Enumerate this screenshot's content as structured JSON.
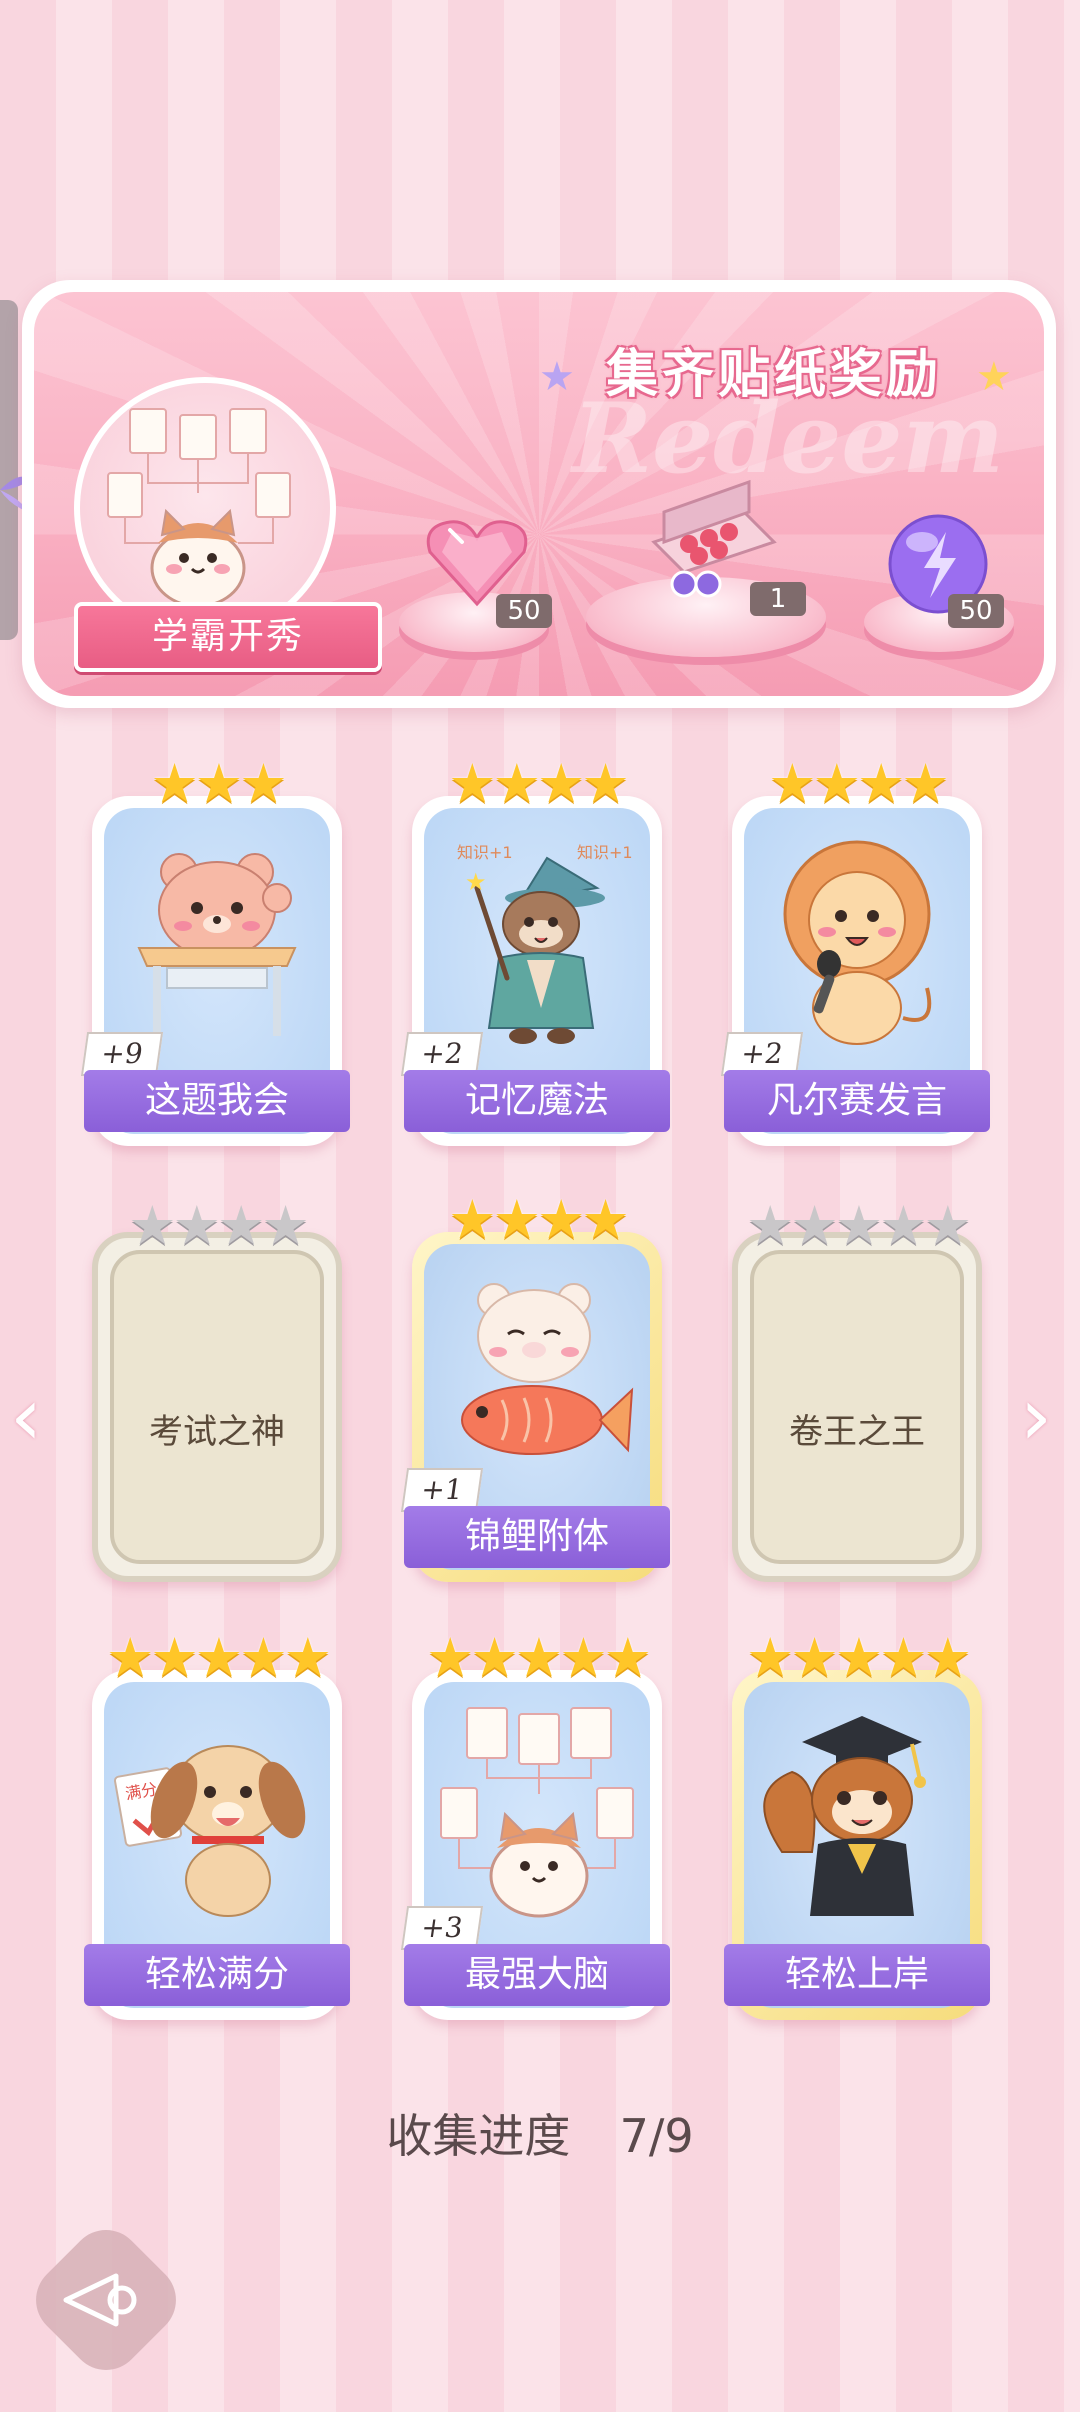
{
  "banner": {
    "title": "集齐贴纸奖励",
    "watermark": "Redeem",
    "ribbon_label": "学霸开秀",
    "rewards": [
      {
        "icon": "pink-gem-heart-icon",
        "count": "50"
      },
      {
        "icon": "gift-box-icon",
        "count": "1"
      },
      {
        "icon": "lightning-orb-icon",
        "count": "50"
      }
    ]
  },
  "cards": [
    {
      "label": "这题我会",
      "stars": 3,
      "max_stars": 3,
      "bonus": "+9",
      "state": "collected",
      "critter": "bear-at-desk"
    },
    {
      "label": "记忆魔法",
      "stars": 4,
      "max_stars": 4,
      "bonus": "+2",
      "state": "collected",
      "critter": "otter-wizard"
    },
    {
      "label": "凡尔赛发言",
      "stars": 4,
      "max_stars": 4,
      "bonus": "+2",
      "state": "collected",
      "critter": "lion-mic"
    },
    {
      "label": "考试之神",
      "stars": 0,
      "max_stars": 4,
      "bonus": "",
      "state": "locked"
    },
    {
      "label": "锦鲤附体",
      "stars": 4,
      "max_stars": 4,
      "bonus": "+1",
      "state": "gold",
      "critter": "bear-koi"
    },
    {
      "label": "卷王之王",
      "stars": 0,
      "max_stars": 5,
      "bonus": "",
      "state": "locked"
    },
    {
      "label": "轻松满分",
      "stars": 5,
      "max_stars": 5,
      "bonus": "",
      "state": "collected",
      "critter": "puppy-paper"
    },
    {
      "label": "最强大脑",
      "stars": 5,
      "max_stars": 5,
      "bonus": "+3",
      "state": "collected",
      "critter": "cat-papers"
    },
    {
      "label": "轻松上岸",
      "stars": 5,
      "max_stars": 5,
      "bonus": "",
      "state": "gold",
      "critter": "squirrel-grad"
    }
  ],
  "progress": {
    "label": "收集进度",
    "value": "7/9",
    "collected": 7,
    "total": 9
  },
  "colors": {
    "accent_purple": "#8a5fd8",
    "star_gold": "#ffc628",
    "pink": "#f9aec1"
  }
}
